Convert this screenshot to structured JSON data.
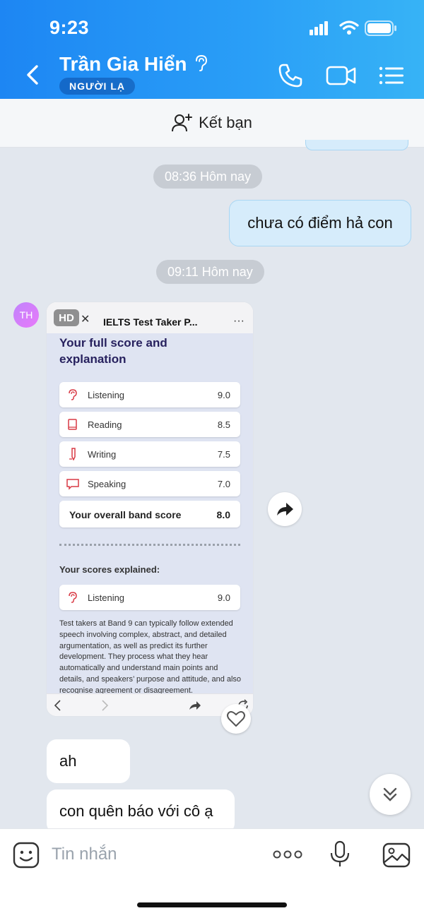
{
  "status_bar": {
    "time": "9:23"
  },
  "header": {
    "contact_name": "Trần Gia Hiển",
    "badge": "NGƯỜI LẠ"
  },
  "friend_bar": {
    "label": "Kết bạn"
  },
  "chat": {
    "timestamp1": "08:36 Hôm nay",
    "outgoing_message": "chưa có điểm hả con",
    "timestamp2": "09:11 Hôm nay",
    "avatar_initials": "TH",
    "image_card": {
      "hd_label": "HD",
      "browser_title": "IELTS Test Taker P...",
      "heading": "Your full score and explanation",
      "scores": [
        {
          "label": "Listening",
          "value": "9.0"
        },
        {
          "label": "Reading",
          "value": "8.5"
        },
        {
          "label": "Writing",
          "value": "7.5"
        },
        {
          "label": "Speaking",
          "value": "7.0"
        }
      ],
      "overall_label": "Your overall band score",
      "overall_value": "8.0",
      "explained_heading": "Your scores explained:",
      "explained_row": {
        "label": "Listening",
        "value": "9.0"
      },
      "paragraph": "Test takers at Band 9 can typically follow extended speech involving complex, abstract, and detailed argumentation, as well as predict its further development. They process what they hear automatically and understand main points and details, and speakers’ purpose and attitude, and also recognise agreement or disagreement."
    },
    "incoming_messages": [
      "ah",
      "con quên báo với cô ạ"
    ]
  },
  "input": {
    "placeholder": "Tin nhắn"
  },
  "colors": {
    "header_start": "#1d86f3",
    "header_end": "#37b3f6",
    "outgoing_bubble": "#d6ecfb",
    "chat_bg": "#e2e7ee",
    "score_accent": "#d93a45"
  }
}
